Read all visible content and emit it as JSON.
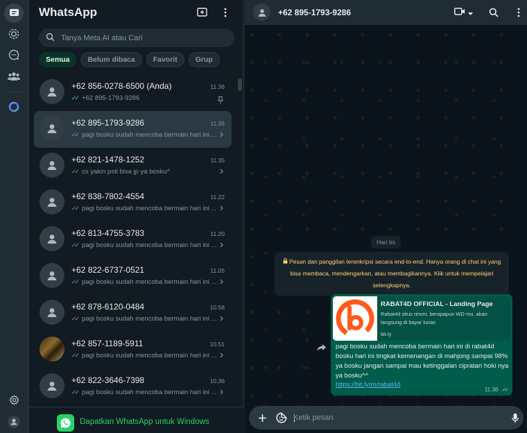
{
  "app": {
    "title": "WhatsApp"
  },
  "search": {
    "placeholder": "Tanya Meta AI atau Cari"
  },
  "filters": [
    "Semua",
    "Belum dibaca",
    "Favorit",
    "Grup"
  ],
  "chats": [
    {
      "name": "+62 856-0278-6500 (Anda)",
      "time": "11.36",
      "preview": "+62 895-1793-9286",
      "ticks": "✓✓",
      "tick_color": "#53bdeb",
      "pinned": true,
      "avatar": "default"
    },
    {
      "name": "+62 895-1793-9286",
      "time": "11.36",
      "preview": "pagi bosku sudah mencoba bermain hari ini ...",
      "ticks": "✓✓",
      "tick_color": "#8696a0",
      "selected": true,
      "avatar": "default"
    },
    {
      "name": "+62 821-1478-1252",
      "time": "11.35",
      "preview": "cs yakin psti bisa jp ya bosku^",
      "ticks": "✓✓",
      "tick_color": "#8696a0",
      "avatar": "default"
    },
    {
      "name": "+62 838-7802-4554",
      "time": "11.22",
      "preview": "pagi bosku sudah mencoba bermain hari ini ...",
      "ticks": "✓✓",
      "tick_color": "#8696a0",
      "avatar": "default"
    },
    {
      "name": "+62 813-4755-3783",
      "time": "11.20",
      "preview": "pagi bosku sudah mencoba bermain hari ini ...",
      "ticks": "✓✓",
      "tick_color": "#8696a0",
      "avatar": "default"
    },
    {
      "name": "+62 822-6737-0521",
      "time": "11.05",
      "preview": "pagi bosku sudah mencoba bermain hari ini ...",
      "ticks": "✓✓",
      "tick_color": "#8696a0",
      "avatar": "default"
    },
    {
      "name": "+62 878-6120-0484",
      "time": "10.58",
      "preview": "pagi bosku sudah mencoba bermain hari ini ...",
      "ticks": "✓✓",
      "tick_color": "#8696a0",
      "avatar": "default"
    },
    {
      "name": "+62 857-1189-5911",
      "time": "10.51",
      "preview": "pagi bosku sudah mencoba bermain hari ini ...",
      "ticks": "✓✓",
      "tick_color": "#8696a0",
      "avatar": "photo"
    },
    {
      "name": "+62 822-3646-7398",
      "time": "10.36",
      "preview": "pagi bosku sudah mencoba bermain hari ini ...",
      "ticks": "✓✓",
      "tick_color": "#8696a0",
      "avatar": "default"
    }
  ],
  "get_app": {
    "label": "Dapatkan WhatsApp untuk Windows"
  },
  "conversation": {
    "name": "+62 895-1793-9286",
    "day_label": "Hari Ini",
    "e2e_notice": "Pesan dan panggilan terenkripsi secara end-to-end. Hanya orang di chat ini yang bisa membaca, mendengarkan, atau membagikannya. Klik untuk mempelajari selengkapnya.",
    "message": {
      "preview_title": "RABAT4D OFFICIAL - Landing Page",
      "preview_desc": "Rabat4d situs resmi, berapapun WD mu, akan langsung di bayar lunas",
      "preview_domain": "bit.ly",
      "text": "pagi bosku sudah mencoba bermain hari ini di rabat4d bosku hari ini tingkat kemenangan di mahjong sampai 98% ya bosku jangan sampai mau ketinggalan cipratan hoki nya ya bosku^^",
      "link": "https://bit.ly/m/rabat4d",
      "time": "11.36",
      "ticks": "✓✓"
    }
  },
  "composer": {
    "placeholder": "Ketik pesan"
  },
  "colors": {
    "accent": "#25d366",
    "bubble_out": "#005c4b",
    "panel": "#202c33",
    "bg": "#111b21",
    "notice": "#ffd279"
  }
}
